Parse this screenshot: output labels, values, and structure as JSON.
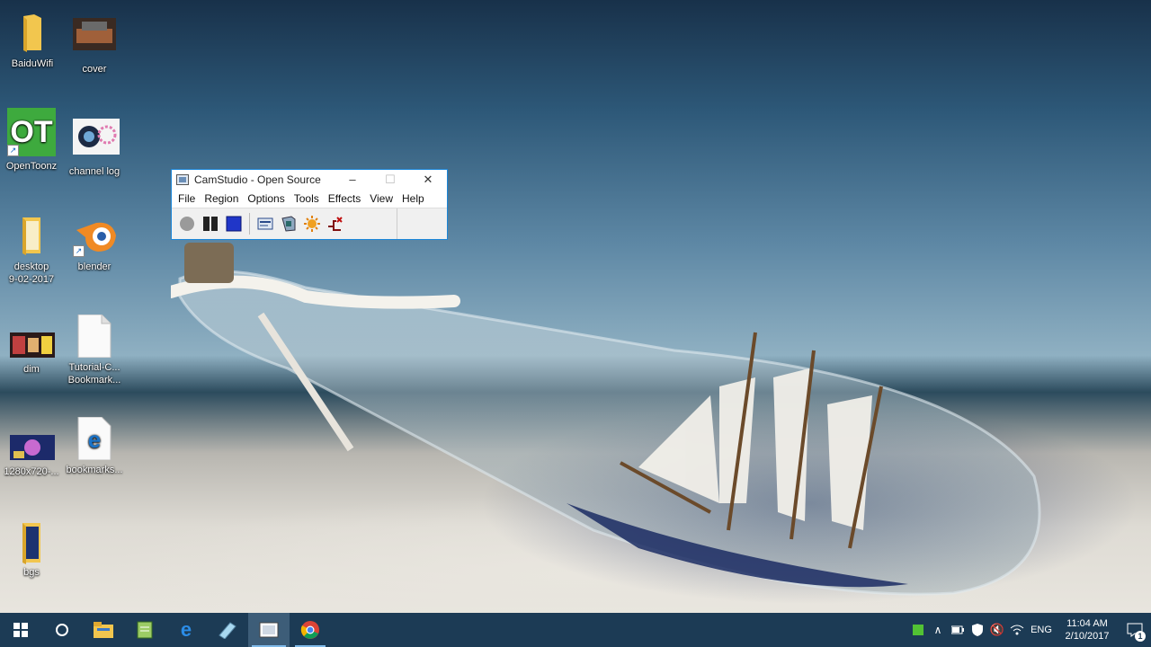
{
  "desktop": {
    "icons": [
      {
        "label": "BaiduWifi",
        "kind": "folder-icon"
      },
      {
        "label": "cover",
        "kind": "image-thumbnail-icon"
      },
      {
        "label": "OpenToonz",
        "kind": "opentoonz-icon"
      },
      {
        "label": "channel log",
        "kind": "image-thumbnail-icon"
      },
      {
        "label": "desktop\n9-02-2017",
        "kind": "folder-icon"
      },
      {
        "label": "blender",
        "kind": "blender-icon"
      },
      {
        "label": "dim",
        "kind": "image-thumbnail-icon"
      },
      {
        "label": "Tutorial-C...\nBookmark...",
        "kind": "document-icon"
      },
      {
        "label": "1280x720-...",
        "kind": "image-thumbnail-icon"
      },
      {
        "label": "bookmarks...",
        "kind": "edge-file-icon"
      },
      {
        "label": "bgs",
        "kind": "folder-icon"
      }
    ]
  },
  "camstudio": {
    "title": "CamStudio - Open Source",
    "controls": {
      "minimize": "–",
      "maximize": "☐",
      "close": "✕"
    },
    "menu": [
      "File",
      "Region",
      "Options",
      "Tools",
      "Effects",
      "View",
      "Help"
    ],
    "toolbar": [
      "record-icon",
      "pause-icon",
      "stop-icon",
      "region-select-icon",
      "annotation-icon",
      "autopan-icon",
      "exit-icon"
    ]
  },
  "taskbar": {
    "buttons": [
      "windows-start-icon",
      "cortana-search-icon",
      "file-explorer-icon",
      "notepad-icon",
      "edge-browser-icon",
      "notepad-plus-icon",
      "camstudio-icon",
      "chrome-icon"
    ],
    "tray": {
      "language": "ENG",
      "time": "11:04 AM",
      "date": "2/10/2017",
      "notification_count": "1"
    }
  },
  "colors": {
    "taskbar": "#1c3b55",
    "window_border": "#1b86d8",
    "close_red": "#e81123"
  }
}
